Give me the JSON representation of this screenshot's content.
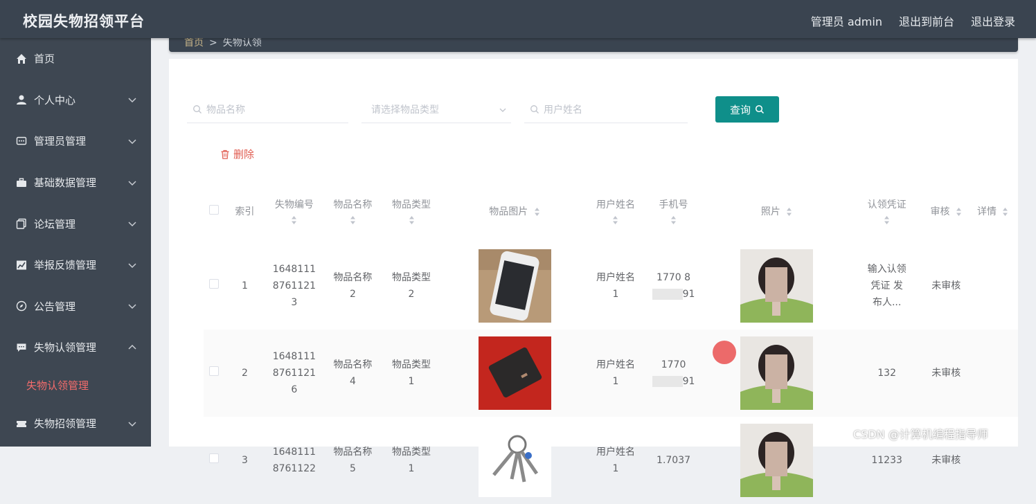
{
  "app": {
    "title": "校园失物招领平台",
    "admin_label": "管理员 admin",
    "to_front_label": "退出到前台",
    "logout_label": "退出登录"
  },
  "sidebar": {
    "items": [
      {
        "label": "首页",
        "icon": "home-icon",
        "has_children": false
      },
      {
        "label": "个人中心",
        "icon": "user-icon",
        "has_children": true
      },
      {
        "label": "管理员管理",
        "icon": "chat-icon",
        "has_children": true
      },
      {
        "label": "基础数据管理",
        "icon": "briefcase-icon",
        "has_children": true
      },
      {
        "label": "论坛管理",
        "icon": "copy-icon",
        "has_children": true
      },
      {
        "label": "举报反馈管理",
        "icon": "chart-icon",
        "has_children": true
      },
      {
        "label": "公告管理",
        "icon": "compass-icon",
        "has_children": true
      },
      {
        "label": "失物认领管理",
        "icon": "message-icon",
        "has_children": true,
        "expanded": true,
        "children": [
          {
            "label": "失物认领管理",
            "active": true
          }
        ]
      },
      {
        "label": "失物招领管理",
        "icon": "ticket-icon",
        "has_children": true
      }
    ]
  },
  "breadcrumb": {
    "home": "首页",
    "separator": ">",
    "current": "失物认领"
  },
  "search": {
    "item_name_placeholder": "物品名称",
    "item_type_placeholder": "请选择物品类型",
    "user_name_placeholder": "用户姓名",
    "query_label": "查询"
  },
  "actions": {
    "delete_label": "删除"
  },
  "table": {
    "columns": [
      "索引",
      "失物编号",
      "物品名称",
      "物品类型",
      "物品图片",
      "用户姓名",
      "手机号",
      "照片",
      "认领凭证",
      "审核",
      "详情"
    ],
    "rows": [
      {
        "index": "1",
        "code_a": "1648111",
        "code_b": "8761121",
        "code_c": "3",
        "name_a": "物品名称",
        "name_b": "2",
        "type_a": "物品类型",
        "type_b": "2",
        "image": "phone-photo",
        "user_a": "用户姓名",
        "user_b": "1",
        "phone_a": "1770",
        "phone_b": "8",
        "phone_c": "91",
        "voucher_a": "输入认领",
        "voucher_b": "凭证 发",
        "voucher_c": "布人...",
        "status": "未审核"
      },
      {
        "index": "2",
        "code_a": "1648111",
        "code_b": "8761121",
        "code_c": "6",
        "name_a": "物品名称",
        "name_b": "4",
        "type_a": "物品类型",
        "type_b": "1",
        "image": "wallet-photo",
        "user_a": "用户姓名",
        "user_b": "1",
        "phone_a": "1770",
        "phone_b": "",
        "phone_c": "91",
        "voucher_a": "132",
        "voucher_b": "",
        "voucher_c": "",
        "status": "未审核"
      },
      {
        "index": "3",
        "code_a": "1648111",
        "code_b": "8761122",
        "code_c": "",
        "name_a": "物品名称",
        "name_b": "5",
        "type_a": "物品类型",
        "type_b": "1",
        "image": "keys-photo",
        "user_a": "用户姓名",
        "user_b": "1",
        "phone_a": "1.7037",
        "phone_b": "",
        "phone_c": "",
        "voucher_a": "11233",
        "voucher_b": "",
        "voucher_c": "",
        "status": "未审核"
      }
    ]
  },
  "watermark": "CSDN @计算机编程指导师",
  "colors": {
    "sidebar_bg": "#3e4752",
    "topbar_bg": "#3a4450",
    "accent": "#0f8f8a",
    "danger": "#e05b4f",
    "active_menu": "#f56c6c"
  }
}
